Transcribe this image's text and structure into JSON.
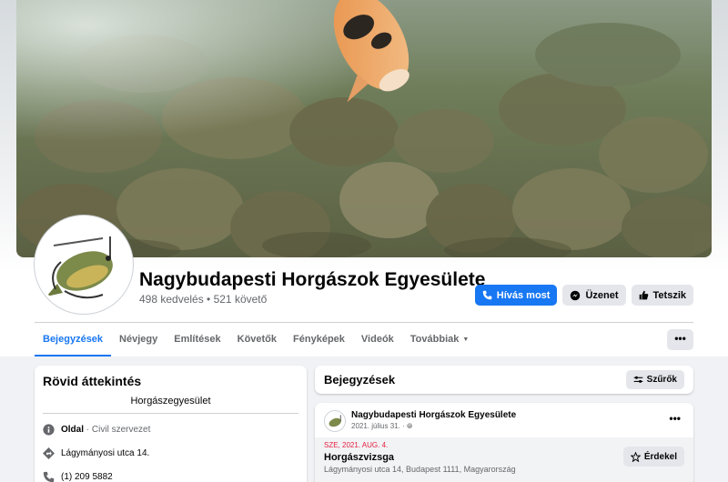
{
  "page": {
    "name": "Nagybudapesti Horgászok Egyesülete",
    "stats": "498 kedvelés • 521 követő"
  },
  "actions": {
    "call_label": "Hívás most",
    "message_label": "Üzenet",
    "like_label": "Tetszik"
  },
  "tabs": [
    {
      "label": "Bejegyzések",
      "active": true
    },
    {
      "label": "Névjegy"
    },
    {
      "label": "Említések"
    },
    {
      "label": "Követők"
    },
    {
      "label": "Fényképek"
    },
    {
      "label": "Videók"
    },
    {
      "label": "Továbbiak"
    }
  ],
  "more_button": "•••",
  "overview": {
    "title": "Rövid áttekintés",
    "category": "Horgászegyesület",
    "items": [
      {
        "icon": "info-icon",
        "bold": "Oldal",
        "text": " · Civil szervezet"
      },
      {
        "icon": "location-icon",
        "text": "Lágymányosi utca 14."
      },
      {
        "icon": "phone-icon",
        "text": "(1) 209 5882"
      }
    ]
  },
  "posts_section": {
    "title": "Bejegyzések",
    "filter_label": "Szűrők"
  },
  "post": {
    "author": "Nagybudapesti Horgászok Egyesülete",
    "date": "2021. július 31. ·",
    "more": "•••",
    "event": {
      "date": "SZE, 2021. AUG. 4.",
      "title": "Horgászvizsga",
      "location": "Lágymányosi utca 14, Budapest 1111, Magyarország",
      "interest_label": "Érdekel"
    }
  },
  "colors": {
    "accent": "#1877f2",
    "background": "#f0f2f5",
    "event_date": "#e41e3f"
  }
}
